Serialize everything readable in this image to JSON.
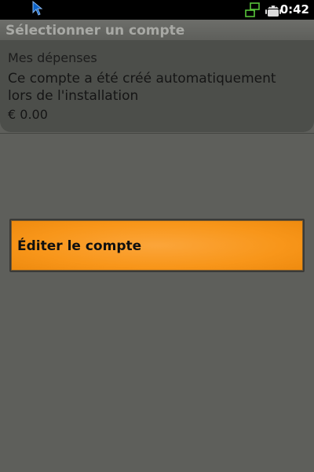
{
  "status_bar": {
    "time": "0:42",
    "icons": [
      "cursor-icon",
      "network-icon",
      "android-icon"
    ]
  },
  "title": "Sélectionner un compte",
  "account": {
    "name": "Mes dépenses",
    "description": "Ce compte a été créé automatiquement lors de l'installation",
    "amount": "€ 0.00"
  },
  "context_menu": {
    "item_label": "Éditer le compte"
  },
  "colors": {
    "background": "#5e5f5b",
    "card": "#4c4e4a",
    "accent": "#f8961a",
    "status_bar": "#000000"
  }
}
